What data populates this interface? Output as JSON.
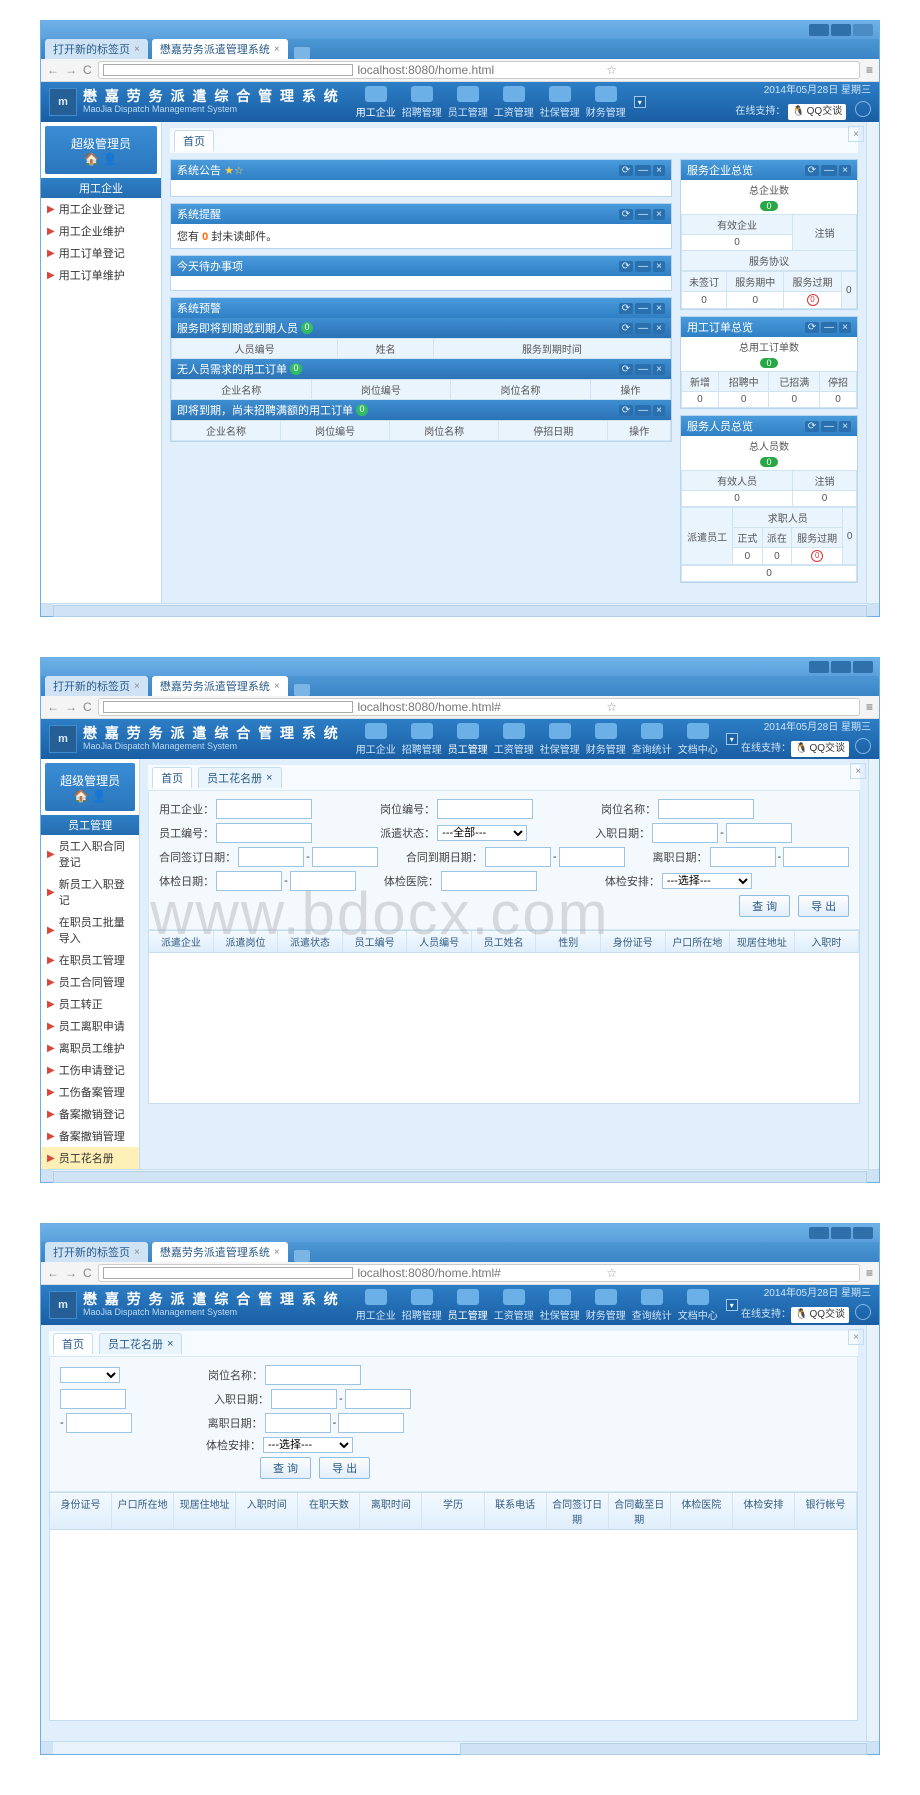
{
  "browser": {
    "tabs": [
      "打开新的标签页",
      "懋嘉劳务派遣管理系统"
    ],
    "url": "localhost:8080/home.html",
    "url_hash": "localhost:8080/home.html#"
  },
  "app": {
    "title_cn": "懋 嘉 劳 务 派 遣 综 合 管 理 系 统",
    "title_en": "MaoJia Dispatch Management System",
    "date": "2014年05月28日 星期三",
    "support_label": "在线支持：",
    "qq_label": "QQ交谈"
  },
  "topnav": {
    "items": [
      "用工企业",
      "招聘管理",
      "员工管理",
      "工资管理",
      "社保管理",
      "财务管理",
      "查询统计",
      "文档中心"
    ]
  },
  "sidebar": {
    "admin": "超级管理员",
    "cat1": {
      "title": "用工企业",
      "items": [
        "用工企业登记",
        "用工企业维护",
        "用工订单登记",
        "用工订单维护"
      ]
    },
    "cat2": {
      "title": "员工管理",
      "items": [
        "员工入职合同登记",
        "新员工入职登记",
        "在职员工批量导入",
        "在职员工管理",
        "员工合同管理",
        "员工转正",
        "员工离职申请",
        "离职员工维护",
        "工伤申请登记",
        "工伤备案管理",
        "备案撤销登记",
        "备案撤销管理",
        "员工花名册"
      ]
    }
  },
  "close_x": "×",
  "shot1": {
    "pagetab_home": "首页",
    "panels": {
      "notice": {
        "title": "系统公告",
        "star": "★☆"
      },
      "reminder": {
        "title": "系统提醒",
        "body_pre": "您有",
        "body_count": "0",
        "body_post": "封未读邮件。"
      },
      "todo": {
        "title": "今天待办事项"
      },
      "warning": {
        "title": "系统预警"
      },
      "expire": {
        "title": "服务即将到期或到期人员",
        "badge": "0",
        "cols": [
          "人员编号",
          "姓名",
          "服务到期时间"
        ]
      },
      "noorder": {
        "title": "无人员需求的用工订单",
        "badge": "0",
        "cols": [
          "企业名称",
          "岗位编号",
          "岗位名称",
          "操作"
        ]
      },
      "dueorder": {
        "title": "即将到期，尚未招聘满额的用工订单",
        "badge": "0",
        "cols": [
          "企业名称",
          "岗位编号",
          "岗位名称",
          "停招日期",
          "操作"
        ]
      },
      "ent": {
        "title": "服务企业总览",
        "total_lbl": "总企业数",
        "total": "0",
        "active_lbl": "有效企业",
        "active": "0",
        "cancel_lbl": "注销",
        "agree_lbl": "服务协议",
        "agree_cancel": "0",
        "cols": [
          "未签订",
          "服务期中",
          "服务过期"
        ],
        "vals": [
          "0",
          "0"
        ],
        "expired_icon": "0"
      },
      "orders": {
        "title": "用工订单总览",
        "total_lbl": "总用工订单数",
        "total": "0",
        "cols": [
          "新增",
          "招聘中",
          "已招满",
          "停招"
        ],
        "vals": [
          "0",
          "0",
          "0",
          "0"
        ]
      },
      "staff": {
        "title": "服务人员总览",
        "total_lbl": "总人员数",
        "total": "0",
        "active_lbl": "有效人员",
        "active": "0",
        "cancel_lbl": "注销",
        "cancel": "0",
        "cat1": "派遣员工",
        "cat2": "求职人员",
        "cols": [
          "正式",
          "派在",
          "服务过期"
        ],
        "vals": [
          "0",
          "0"
        ],
        "zero": "0"
      }
    },
    "panel_ctl": [
      "⟳",
      "—",
      "×"
    ]
  },
  "shot2": {
    "pagetabs": [
      "首页",
      "员工花名册"
    ],
    "form": {
      "f_company": "用工企业：",
      "f_postno": "岗位编号：",
      "f_postname": "岗位名称：",
      "f_empno": "员工编号：",
      "f_status": "派遣状态：",
      "status_all": "---全部---",
      "f_entry": "入职日期：",
      "f_contract": "合同签订日期：",
      "f_contract_end": "合同到期日期：",
      "f_leave": "离职日期：",
      "f_ins": "体检日期：",
      "f_ins2": "体检医院：",
      "f_arrange": "体检安排：",
      "arrange_opt": "---选择---",
      "btn_search": "查 询",
      "btn_export": "导 出",
      "dash": "-"
    },
    "grid_cols": [
      "派遣企业",
      "派遣岗位",
      "派遣状态",
      "员工编号",
      "人员编号",
      "员工姓名",
      "性别",
      "身份证号",
      "户口所在地",
      "现居住地址",
      "入职时"
    ]
  },
  "shot3": {
    "pagetabs": [
      "首页",
      "员工花名册"
    ],
    "form": {
      "f_postname": "岗位名称：",
      "f_entry": "入职日期：",
      "f_leave": "离职日期：",
      "f_arrange": "体检安排：",
      "arrange_opt": "---选择---",
      "btn_search": "查 询",
      "btn_export": "导 出",
      "dash": "-"
    },
    "grid_cols": [
      "身份证号",
      "户口所在地",
      "现居住地址",
      "入职时间",
      "在职天数",
      "离职时间",
      "学历",
      "联系电话",
      "合同签订日期",
      "合同截至日期",
      "体检医院",
      "体检安排",
      "银行帐号"
    ]
  },
  "watermark": "www.bdocx.com"
}
